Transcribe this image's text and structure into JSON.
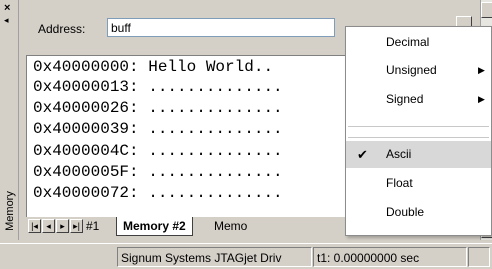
{
  "dock": {
    "title": "Memory",
    "close_glyph": "×",
    "pin_glyph": "◂"
  },
  "address": {
    "label": "Address:",
    "value": "buff"
  },
  "memory_lines": [
    "0x40000000: Hello World..",
    "0x40000013: ..............",
    "0x40000026: ..............",
    "0x40000039: ..............",
    "0x4000004C: ..............",
    "0x4000005F: ..............",
    "0x40000072: .............."
  ],
  "tabs": {
    "nav": [
      "|◂",
      "◂",
      "▸",
      "▸|"
    ],
    "items": [
      "#1",
      "Memory #2",
      "Memo"
    ]
  },
  "menu": {
    "items": [
      {
        "label": "Decimal",
        "submenu": false,
        "checked": false
      },
      {
        "label": "Unsigned",
        "submenu": true,
        "checked": false
      },
      {
        "label": "Signed",
        "submenu": true,
        "checked": false
      },
      {
        "label": "Ascii",
        "submenu": false,
        "checked": true
      },
      {
        "label": "Float",
        "submenu": false,
        "checked": false
      },
      {
        "label": "Double",
        "submenu": false,
        "checked": false
      }
    ],
    "submenu_glyph": "▶",
    "check_glyph": "✔"
  },
  "status": {
    "connection": "Signum Systems JTAGjet Driv",
    "time": "t1: 0.00000000 sec"
  }
}
